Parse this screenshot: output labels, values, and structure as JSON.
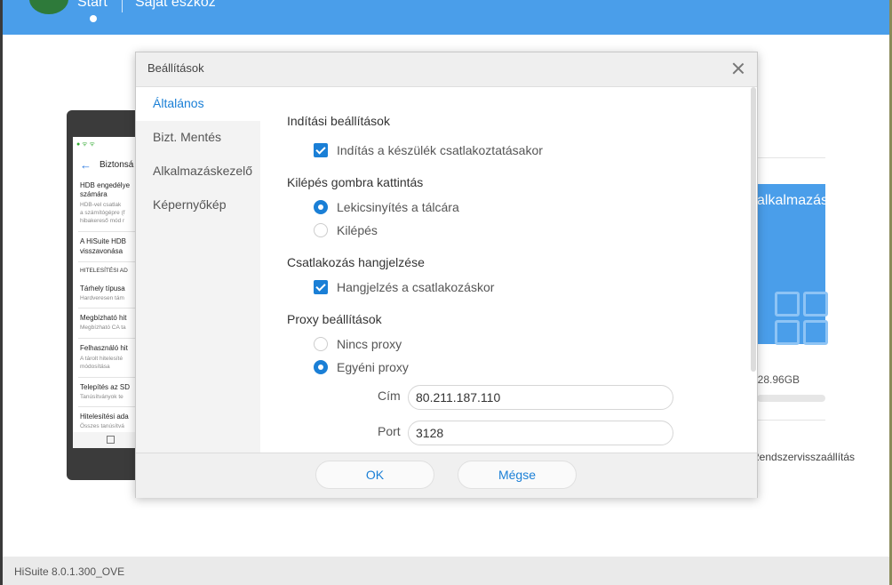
{
  "app": {
    "nav_start": "Start",
    "nav_device": "Saját eszköz",
    "version": "HiSuite 8.0.1.300_OVE"
  },
  "phone": {
    "title": "Biztonsá",
    "items": [
      {
        "label": "HDB engedélye",
        "label2": "számára",
        "sub": [
          "HDB-vel csatlak",
          "a számítógépre (f",
          "hibakereső mód r"
        ]
      },
      {
        "label": "A HiSuite HDB",
        "label2": "visszavonása"
      },
      {
        "head": "HITELESÍTÉSI AD"
      },
      {
        "label": "Tárhely típusa",
        "sub": [
          "Hardveresen tám"
        ]
      },
      {
        "label": "Megbízható hit",
        "sub": [
          "Megbízható CA ta"
        ]
      },
      {
        "label": "Felhasználó hit",
        "sub": [
          "A tárolt hitelesíté",
          "módosítása"
        ]
      },
      {
        "label": "Telepítés az SD",
        "sub": [
          "Tanúsítványok te"
        ]
      },
      {
        "label": "Hitelesítési ada",
        "sub": [
          "Összes tanúsítvá"
        ]
      }
    ]
  },
  "background_right": {
    "card_label": "alkalmazás",
    "storage": "/ 28.96GB",
    "restore": "Rendszervisszaállítás"
  },
  "dialog": {
    "title": "Beállítások",
    "sidebar": [
      {
        "label": "Általános",
        "active": true
      },
      {
        "label": "Bizt. Mentés",
        "active": false
      },
      {
        "label": "Alkalmazáskezelő",
        "active": false
      },
      {
        "label": "Képernyőkép",
        "active": false
      }
    ],
    "startup": {
      "title": "Indítási beállítások",
      "launch_on_connect": "Indítás a készülék csatlakoztatásakor"
    },
    "exit": {
      "title": "Kilépés gombra kattintás",
      "minimize": "Lekicsinyítés a tálcára",
      "quit": "Kilépés"
    },
    "sound": {
      "title": "Csatlakozás hangjelzése",
      "beep": "Hangjelzés a csatlakozáskor"
    },
    "proxy": {
      "title": "Proxy beállítások",
      "none": "Nincs proxy",
      "custom": "Egyéni proxy",
      "address_label": "Cím",
      "address_value": "80.211.187.110",
      "port_label": "Port",
      "port_value": "3128"
    },
    "ok": "OK",
    "cancel": "Mégse"
  },
  "colors": {
    "accent": "#1a7fd6",
    "topbar": "#4a9eea"
  }
}
